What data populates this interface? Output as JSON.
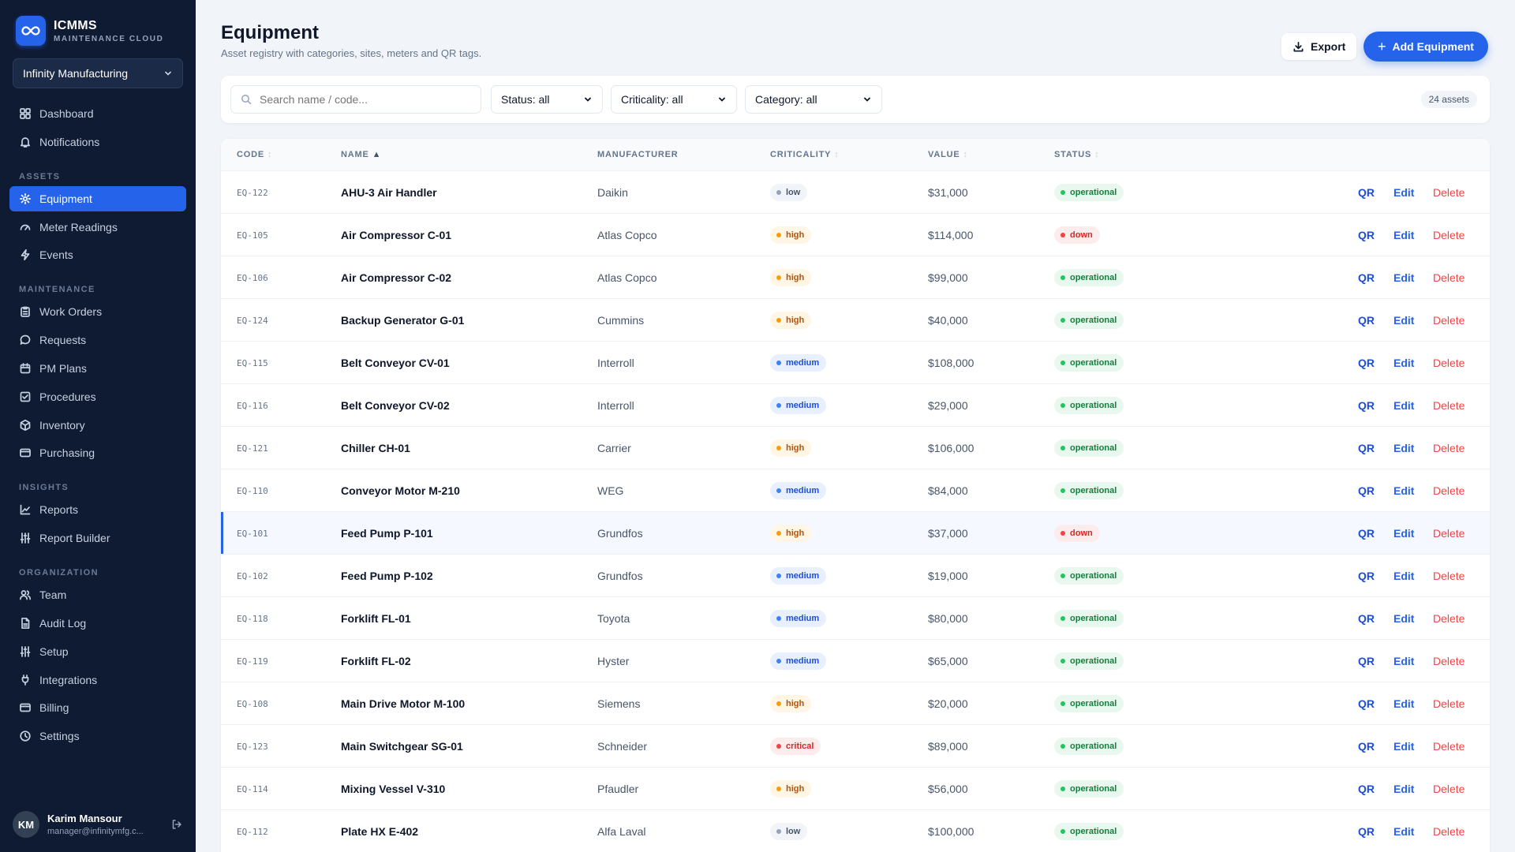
{
  "brand": {
    "name": "ICMMS",
    "subtitle": "MAINTENANCE CLOUD"
  },
  "org_select": {
    "value": "Infinity Manufacturing"
  },
  "nav": {
    "top": [
      {
        "label": "Dashboard",
        "icon": "dashboard-icon"
      },
      {
        "label": "Notifications",
        "icon": "bell-icon"
      }
    ],
    "sections": [
      {
        "title": "ASSETS",
        "items": [
          {
            "label": "Equipment",
            "icon": "gear-icon",
            "active": true
          },
          {
            "label": "Meter Readings",
            "icon": "gauge-icon"
          },
          {
            "label": "Events",
            "icon": "bolt-icon"
          }
        ]
      },
      {
        "title": "MAINTENANCE",
        "items": [
          {
            "label": "Work Orders",
            "icon": "clipboard-icon"
          },
          {
            "label": "Requests",
            "icon": "chat-icon"
          },
          {
            "label": "PM Plans",
            "icon": "calendar-icon"
          },
          {
            "label": "Procedures",
            "icon": "checklist-icon"
          },
          {
            "label": "Inventory",
            "icon": "box-icon"
          },
          {
            "label": "Purchasing",
            "icon": "card-icon"
          }
        ]
      },
      {
        "title": "INSIGHTS",
        "items": [
          {
            "label": "Reports",
            "icon": "chart-icon"
          },
          {
            "label": "Report Builder",
            "icon": "sliders-icon"
          }
        ]
      },
      {
        "title": "ORGANIZATION",
        "items": [
          {
            "label": "Team",
            "icon": "users-icon"
          },
          {
            "label": "Audit Log",
            "icon": "file-icon"
          },
          {
            "label": "Setup",
            "icon": "sliders-icon"
          },
          {
            "label": "Integrations",
            "icon": "plug-icon"
          },
          {
            "label": "Billing",
            "icon": "card-icon"
          },
          {
            "label": "Settings",
            "icon": "clock-icon"
          }
        ]
      }
    ]
  },
  "user": {
    "initials": "KM",
    "name": "Karim Mansour",
    "email": "manager@infinitymfg.c..."
  },
  "header": {
    "title": "Equipment",
    "subtitle": "Asset registry with categories, sites, meters and QR tags.",
    "export_label": "Export",
    "add_label": "Add Equipment"
  },
  "filters": {
    "search_placeholder": "Search name / code...",
    "status": "Status: all",
    "criticality": "Criticality: all",
    "category": "Category: all",
    "count": "24 assets"
  },
  "table": {
    "columns": [
      "CODE",
      "NAME",
      "MANUFACTURER",
      "CRITICALITY",
      "VALUE",
      "STATUS"
    ],
    "actions": {
      "qr": "QR",
      "edit": "Edit",
      "delete": "Delete"
    },
    "rows": [
      {
        "code": "EQ-122",
        "name": "AHU-3 Air Handler",
        "manufacturer": "Daikin",
        "criticality": "low",
        "value": "$31,000",
        "status": "operational"
      },
      {
        "code": "EQ-105",
        "name": "Air Compressor C-01",
        "manufacturer": "Atlas Copco",
        "criticality": "high",
        "value": "$114,000",
        "status": "down"
      },
      {
        "code": "EQ-106",
        "name": "Air Compressor C-02",
        "manufacturer": "Atlas Copco",
        "criticality": "high",
        "value": "$99,000",
        "status": "operational"
      },
      {
        "code": "EQ-124",
        "name": "Backup Generator G-01",
        "manufacturer": "Cummins",
        "criticality": "high",
        "value": "$40,000",
        "status": "operational"
      },
      {
        "code": "EQ-115",
        "name": "Belt Conveyor CV-01",
        "manufacturer": "Interroll",
        "criticality": "medium",
        "value": "$108,000",
        "status": "operational"
      },
      {
        "code": "EQ-116",
        "name": "Belt Conveyor CV-02",
        "manufacturer": "Interroll",
        "criticality": "medium",
        "value": "$29,000",
        "status": "operational"
      },
      {
        "code": "EQ-121",
        "name": "Chiller CH-01",
        "manufacturer": "Carrier",
        "criticality": "high",
        "value": "$106,000",
        "status": "operational"
      },
      {
        "code": "EQ-110",
        "name": "Conveyor Motor M-210",
        "manufacturer": "WEG",
        "criticality": "medium",
        "value": "$84,000",
        "status": "operational"
      },
      {
        "code": "EQ-101",
        "name": "Feed Pump P-101",
        "manufacturer": "Grundfos",
        "criticality": "high",
        "value": "$37,000",
        "status": "down",
        "selected": true
      },
      {
        "code": "EQ-102",
        "name": "Feed Pump P-102",
        "manufacturer": "Grundfos",
        "criticality": "medium",
        "value": "$19,000",
        "status": "operational"
      },
      {
        "code": "EQ-118",
        "name": "Forklift FL-01",
        "manufacturer": "Toyota",
        "criticality": "medium",
        "value": "$80,000",
        "status": "operational"
      },
      {
        "code": "EQ-119",
        "name": "Forklift FL-02",
        "manufacturer": "Hyster",
        "criticality": "medium",
        "value": "$65,000",
        "status": "operational"
      },
      {
        "code": "EQ-108",
        "name": "Main Drive Motor M-100",
        "manufacturer": "Siemens",
        "criticality": "high",
        "value": "$20,000",
        "status": "operational"
      },
      {
        "code": "EQ-123",
        "name": "Main Switchgear SG-01",
        "manufacturer": "Schneider",
        "criticality": "critical",
        "value": "$89,000",
        "status": "operational"
      },
      {
        "code": "EQ-114",
        "name": "Mixing Vessel V-310",
        "manufacturer": "Pfaudler",
        "criticality": "high",
        "value": "$56,000",
        "status": "operational"
      },
      {
        "code": "EQ-112",
        "name": "Plate HX E-402",
        "manufacturer": "Alfa Laval",
        "criticality": "low",
        "value": "$100,000",
        "status": "operational"
      }
    ]
  },
  "colors": {
    "accent": "#2563eb",
    "sidebar_bg": "#0f1b33",
    "low": "#94a3b8",
    "medium": "#3b82f6",
    "high": "#f59e0b",
    "critical": "#ef4444",
    "operational": "#22c55e",
    "down": "#ef4444"
  }
}
